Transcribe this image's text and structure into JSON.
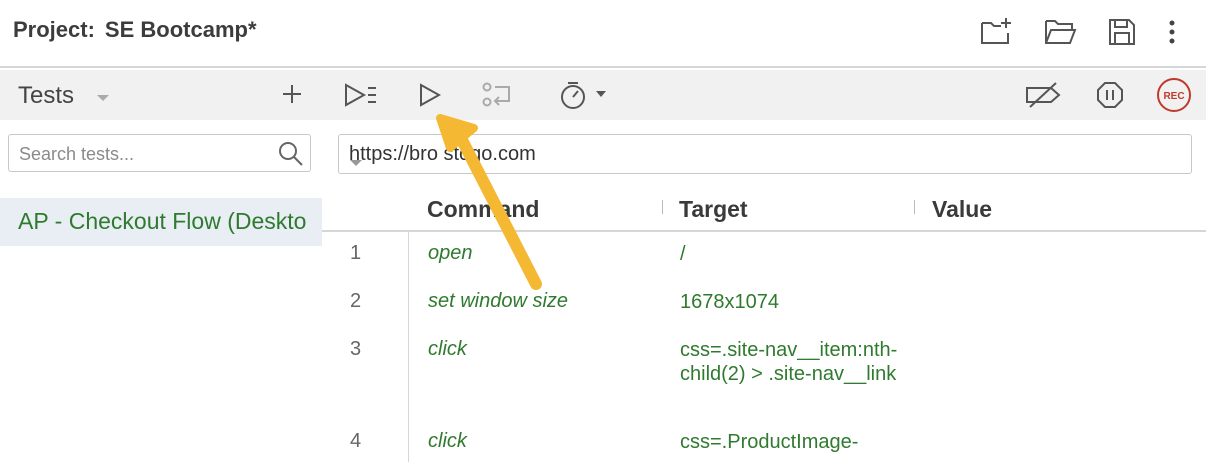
{
  "header": {
    "project_label": "Project:",
    "project_name": "SE Bootcamp*",
    "icons": [
      "new-project-icon",
      "open-folder-icon",
      "save-icon",
      "more-vertical-icon"
    ]
  },
  "sidebar": {
    "title": "Tests",
    "search_placeholder": "Search tests...",
    "tests": [
      {
        "label": "AP - Checkout Flow (Deskto"
      }
    ]
  },
  "toolbar": {
    "icons": [
      "run-all-icon",
      "run-icon",
      "step-icon",
      "speed-timer-icon",
      "disable-breakpoints-icon",
      "pause-icon",
      "record-icon"
    ],
    "record_label": "REC"
  },
  "base_url": {
    "value": "https://bro    stogo.com"
  },
  "table": {
    "columns": [
      "Command",
      "Target",
      "Value"
    ],
    "rows": [
      {
        "num": "1",
        "command": "open",
        "target": "/",
        "value": ""
      },
      {
        "num": "2",
        "command": "set window size",
        "target": "1678x1074",
        "value": ""
      },
      {
        "num": "3",
        "command": "click",
        "target": "css=.site-nav__item:nth-child(2) > .site-nav__link",
        "value": ""
      },
      {
        "num": "4",
        "command": "click",
        "target": "css=.ProductImage-",
        "value": ""
      }
    ]
  },
  "annotation": {
    "color": "#f5b833"
  },
  "colors": {
    "accent_green": "#2f7a2f",
    "record_red": "#c0392b"
  }
}
